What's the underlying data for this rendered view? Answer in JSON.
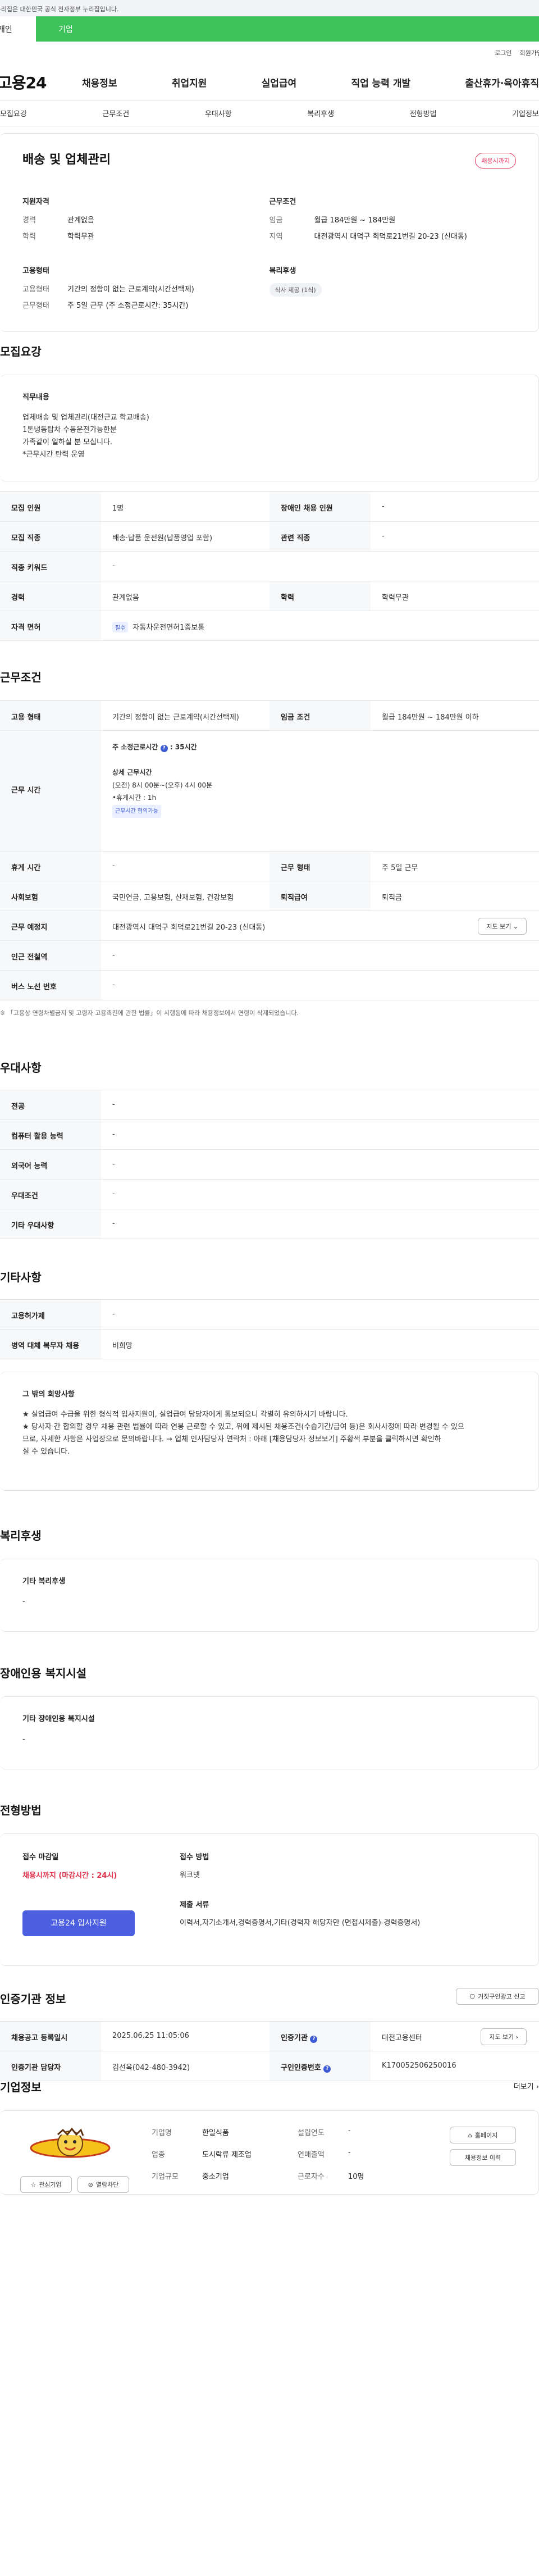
{
  "banner": {
    "text": "이 누리집은 대한민국 공식 전자정부 누리집입니다."
  },
  "tabs": {
    "person": "개인",
    "company": "기업"
  },
  "util": {
    "login": "로그인",
    "signup": "회원가입"
  },
  "gnb": {
    "logo": "고용24",
    "menu": [
      "채용정보",
      "취업지원",
      "실업급여",
      "직업 능력 개발",
      "출산휴가·육아휴직"
    ]
  },
  "subtabs": [
    "모집요강",
    "근무조건",
    "우대사항",
    "복리후생",
    "전형방법",
    "기업정보"
  ],
  "summary": {
    "title": "배송 및 업체관리",
    "badge": "채용시까지",
    "qual": {
      "head": "지원자격",
      "rows": [
        {
          "k": "경력",
          "v": "관계없음"
        },
        {
          "k": "학력",
          "v": "학력무관"
        }
      ]
    },
    "cond": {
      "head": "근무조건",
      "rows": [
        {
          "k": "임금",
          "v": "월급 184만원 ~ 184만원"
        },
        {
          "k": "지역",
          "v": "대전광역시 대덕구 회덕로21번길 20-23 (신대동)"
        }
      ]
    },
    "employ": {
      "head": "고용형태",
      "rows": [
        {
          "k": "고용형태",
          "v": "기간의 정함이 없는 근로계약(시간선택제)"
        },
        {
          "k": "근무형태",
          "v": "주 5일 근무 (주 소정근로시간: 35시간)"
        }
      ]
    },
    "welfare": {
      "head": "복리후생",
      "chip": "식사 제공 (1식)"
    }
  },
  "recruit": {
    "title": "모집요강",
    "duty_head": "직무내용",
    "duty_lines": [
      "업체배송 및 업체관리(대전근교 학교배송)",
      "1톤냉동탑차 수동운전가능한분",
      "가족같이 일하실 분 모십니다.",
      "*근무시간 탄력 운영"
    ],
    "rows": [
      {
        "k1": "모집 인원",
        "v1": "1명",
        "k2": "장애인 채용 인원",
        "v2": "-"
      },
      {
        "k1": "모집 직종",
        "v1": "배송·납품 운전원(납품영업 포함)",
        "k2": "관련 직종",
        "v2": "-"
      },
      {
        "k1": "직종 키워드",
        "v1": "-"
      },
      {
        "k1": "경력",
        "v1": "관계없음",
        "k2": "학력",
        "v2": "학력무관"
      },
      {
        "k1": "자격 면허",
        "v1": "자동차운전면허1종보통",
        "badge": "필수"
      }
    ]
  },
  "work": {
    "title": "근무조건",
    "type_k": "고용 형태",
    "type_v": "기간의 정함이 없는 근로계약(시간선택제)",
    "wage_k": "임금 조건",
    "wage_v": "월급 184만원 ~ 184만원 이하",
    "time_k": "근무 시간",
    "weekly_label": "주 소정근로시간",
    "weekly_value": "35시간",
    "detail_head": "상세 근무시간",
    "detail_line1": "(오전) 8시 00분~(오후) 4시 00분",
    "detail_line2": "•휴게시간 : 1h",
    "detail_badge": "근무시간 협의가능",
    "rest_k": "휴게 시간",
    "rest_v": "-",
    "form_k": "근무 형태",
    "form_v": "주 5일 근무",
    "ins_k": "사회보험",
    "ins_v": "국민연금, 고용보험, 산재보험, 건강보험",
    "ret_k": "퇴직급여",
    "ret_v": "퇴직금",
    "addr_k": "근무 예정지",
    "addr_v": "대전광역시 대덕구 회덕로21번길 20-23 (신대동)",
    "map": "지도 보기",
    "subway_k": "인근 전철역",
    "subway_v": "-",
    "bus_k": "버스 노선 번호",
    "bus_v": "-",
    "note": "※ 「고용상 연령차별금지 및 고령자 고용촉진에 관한 법률」이 시행됨에 따라 채용정보에서 연령이 삭제되었습니다."
  },
  "prefer": {
    "title": "우대사항",
    "rows": [
      {
        "k": "전공",
        "v": "-"
      },
      {
        "k": "컴퓨터 활용 능력",
        "v": "-"
      },
      {
        "k": "외국어 능력",
        "v": "-"
      },
      {
        "k": "우대조건",
        "v": "-"
      },
      {
        "k": "기타 우대사항",
        "v": "-"
      }
    ]
  },
  "etc": {
    "title": "기타사항",
    "rows": [
      {
        "k": "고용허가제",
        "v": "-"
      },
      {
        "k": "병역 대체 복무자 채용",
        "v": "비희망"
      }
    ],
    "wish_head": "그 밖의 희망사항",
    "wish_lines": [
      "★ 실업급여 수급을 위한 형식적 입사지원이, 실업급여 담당자에게 통보되오니 각별히 유의하시기 바랍니다.",
      "★ 당사자 간 합의할 경우 채용 관련 법률에 따라 연봉 근로할 수 있고, 위에 제시된 채용조건(수습기간/급여 등)은 회사사정에 따라 변경될 수 있으",
      "므로, 자세한 사항은 사업장으로 문의바랍니다. → 업체 인사담당자 연락처 : 아래 [채용담당자 정보보기] 주황색 부분을 클릭하시면 확인하",
      "실 수 있습니다."
    ]
  },
  "welfare": {
    "title": "복리후생",
    "head": "기타 복리후생",
    "value": "-"
  },
  "disabled": {
    "title": "장애인용 복지시설",
    "head": "기타 장애인용 복지시설",
    "value": "-"
  },
  "select": {
    "title": "전형방법",
    "deadline_head": "접수 마감일",
    "deadline_value": "채용시까지 (마감시간 : 24시)",
    "apply_btn": "고용24 입사지원",
    "method_head": "접수 방법",
    "method_value": "워크넷",
    "docs_head": "제출 서류",
    "docs_value": "이력서,자기소개서,경력증명서,기타(경력자 해당자만 (면접시제출)-경력증명서)"
  },
  "cert": {
    "title": "인증기관 정보",
    "report_btn": "거짓구인광고 신고",
    "reg_k": "채용공고 등록일시",
    "reg_v": "2025.06.25 11:05:06",
    "org_k": "인증기관",
    "org_v": "대전고용센터",
    "map": "지도 보기",
    "mgr_k": "인증기관 담당자",
    "mgr_v": "김선옥(042-480-3942)",
    "num_k": "구인인증번호",
    "num_v": "K170052506250016"
  },
  "company": {
    "title": "기업정보",
    "more": "더보기",
    "fav_btn": "관심기업",
    "block_btn": "열람차단",
    "rows": [
      {
        "k1": "기업명",
        "v1": "한일식품",
        "k2": "설립연도",
        "v2": "-"
      },
      {
        "k1": "업종",
        "v1": "도시락류 제조업",
        "k2": "연매출액",
        "v2": "-"
      },
      {
        "k1": "기업규모",
        "v1": "중소기업",
        "k2": "근로자수",
        "v2": "10명"
      }
    ],
    "home_btn": "홈페이지",
    "history_btn": "채용정보 이력"
  }
}
